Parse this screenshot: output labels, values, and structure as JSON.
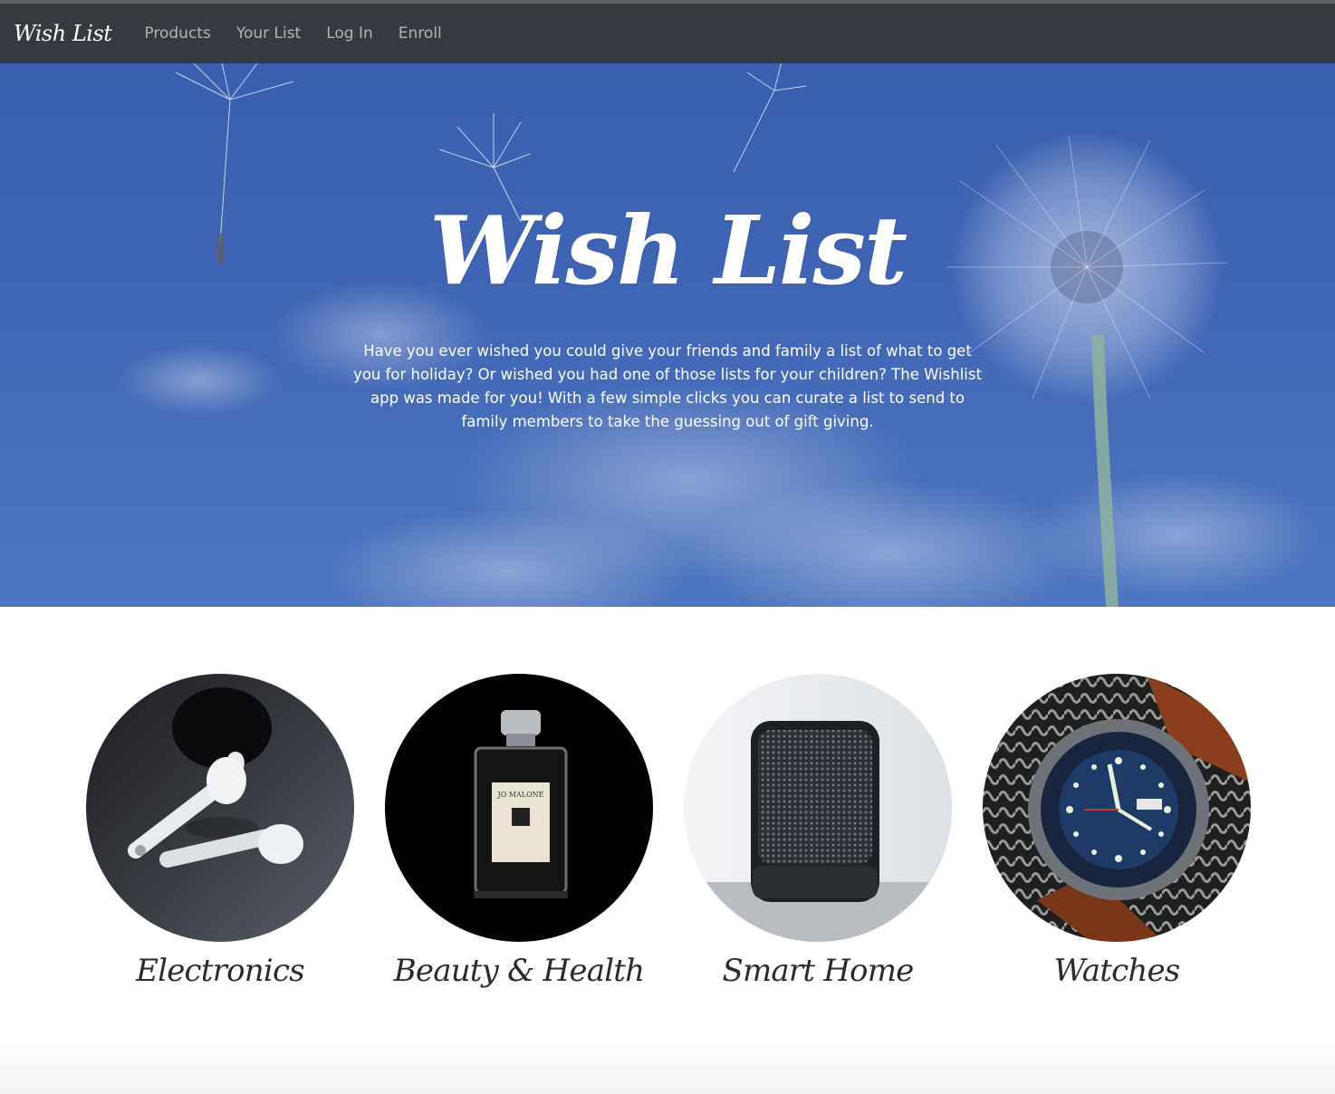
{
  "navbar": {
    "brand": "Wish List",
    "links": [
      "Products",
      "Your List",
      "Log In",
      "Enroll"
    ]
  },
  "hero": {
    "title": "Wish List",
    "text": "Have you ever wished you could give your friends and family a list of what to get you for holiday? Or wished you had one of those lists for your children? The Wishlist app was made for you! With a few simple clicks you can curate a list to send to family members to take the guessing out of gift giving."
  },
  "categories": [
    {
      "label": "Electronics",
      "icon": "earbuds-image"
    },
    {
      "label": "Beauty & Health",
      "icon": "perfume-bottle-image"
    },
    {
      "label": "Smart Home",
      "icon": "speaker-image"
    },
    {
      "label": "Watches",
      "icon": "wristwatch-image"
    }
  ],
  "colors": {
    "navbar": "#343a40",
    "hero_sky": "#4166b6",
    "text_dark": "#2b2b2b"
  }
}
